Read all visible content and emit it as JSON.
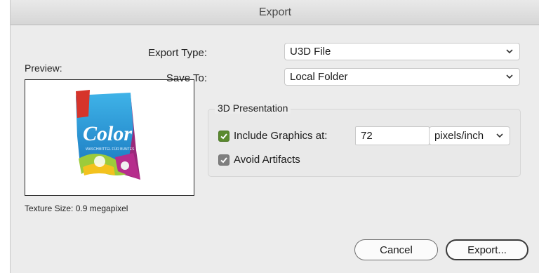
{
  "window": {
    "title": "Export"
  },
  "preview": {
    "label": "Preview:",
    "texture_size": "Texture Size: 0.9 megapixel",
    "product_text": "Color",
    "product_subtext": "WASCHMITTEL FÜR BUNTES",
    "image": "detergent-package-icon"
  },
  "export_type": {
    "label": "Export Type:",
    "value": "U3D File"
  },
  "save_to": {
    "label": "Save To:",
    "value": "Local Folder"
  },
  "presentation": {
    "title": "3D Presentation",
    "include_graphics": {
      "label": "Include Graphics at:",
      "checked": true,
      "value": "72",
      "unit": "pixels/inch"
    },
    "avoid_artifacts": {
      "label": "Avoid Artifacts",
      "checked": true
    }
  },
  "buttons": {
    "cancel": "Cancel",
    "export": "Export..."
  },
  "colors": {
    "checkbox_accent": "#5a8a2e",
    "checkbox_grey": "#7f7f7f"
  }
}
